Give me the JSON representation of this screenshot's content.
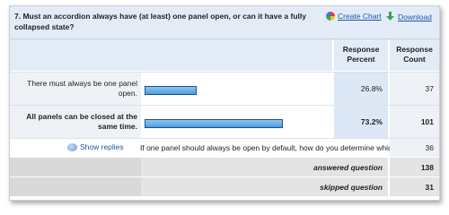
{
  "question": {
    "title": "7. Must an accordion always have (at least) one panel open, or can it have a fully collapsed state?"
  },
  "links": {
    "create_chart": "Create Chart",
    "download": "Download"
  },
  "columns": {
    "percent": "Response Percent",
    "count": "Response Count"
  },
  "answers": [
    {
      "label": "There must always be one panel open.",
      "percent_text": "26.8%",
      "percent": 26.8,
      "count": "37"
    },
    {
      "label": "All panels can be closed at the same time.",
      "percent_text": "73.2%",
      "percent": 73.2,
      "count": "101"
    }
  ],
  "replies": {
    "label": "Show replies",
    "question": "If one panel should always be open by default, how do you determine which one?",
    "count": "36"
  },
  "summary": {
    "answered_label": "answered question",
    "answered_count": "138",
    "skipped_label": "skipped question",
    "skipped_count": "31"
  },
  "colors": {
    "header_bg": "#e3ecf6",
    "link": "#1b57a8",
    "bar": "#4d9ee0"
  }
}
